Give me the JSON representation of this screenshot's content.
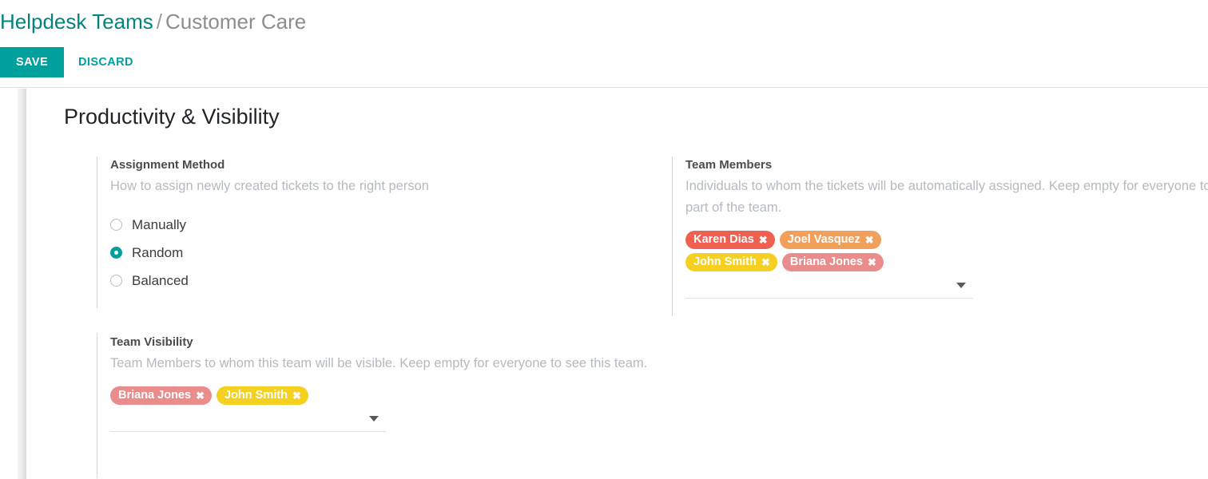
{
  "breadcrumb": {
    "root": "Helpdesk Teams",
    "separator": "/",
    "current": "Customer Care"
  },
  "toolbar": {
    "save_label": "SAVE",
    "discard_label": "DISCARD"
  },
  "sheet": {
    "title": "Productivity & Visibility"
  },
  "assignment": {
    "label": "Assignment Method",
    "help": "How to assign newly created tickets to the right person",
    "options": [
      {
        "label": "Manually",
        "selected": false
      },
      {
        "label": "Random",
        "selected": true
      },
      {
        "label": "Balanced",
        "selected": false
      }
    ]
  },
  "team_members": {
    "label": "Team Members",
    "help": "Individuals to whom the tickets will be automatically assigned. Keep empty for everyone to be part of the team.",
    "tags": [
      {
        "name": "Karen Dias",
        "color": "#f06050",
        "remove_icon": "✖"
      },
      {
        "name": "Joel Vasquez",
        "color": "#f0a05a",
        "remove_icon": "✖"
      },
      {
        "name": "John Smith",
        "color": "#f5d020",
        "remove_icon": "✖"
      },
      {
        "name": "Briana Jones",
        "color": "#eb8c8c",
        "remove_icon": "✖"
      }
    ],
    "dropdown_icon": "caret-down-icon"
  },
  "team_visibility": {
    "label": "Team Visibility",
    "help": "Team Members to whom this team will be visible. Keep empty for everyone to see this team.",
    "tags": [
      {
        "name": "Briana Jones",
        "color": "#eb8c8c",
        "remove_icon": "✖"
      },
      {
        "name": "John Smith",
        "color": "#f5d020",
        "remove_icon": "✖"
      }
    ],
    "dropdown_icon": "caret-down-icon"
  },
  "theme": {
    "accent": "#00a09d",
    "breadcrumb_link": "#00847d",
    "muted_text": "#b5bac0"
  }
}
